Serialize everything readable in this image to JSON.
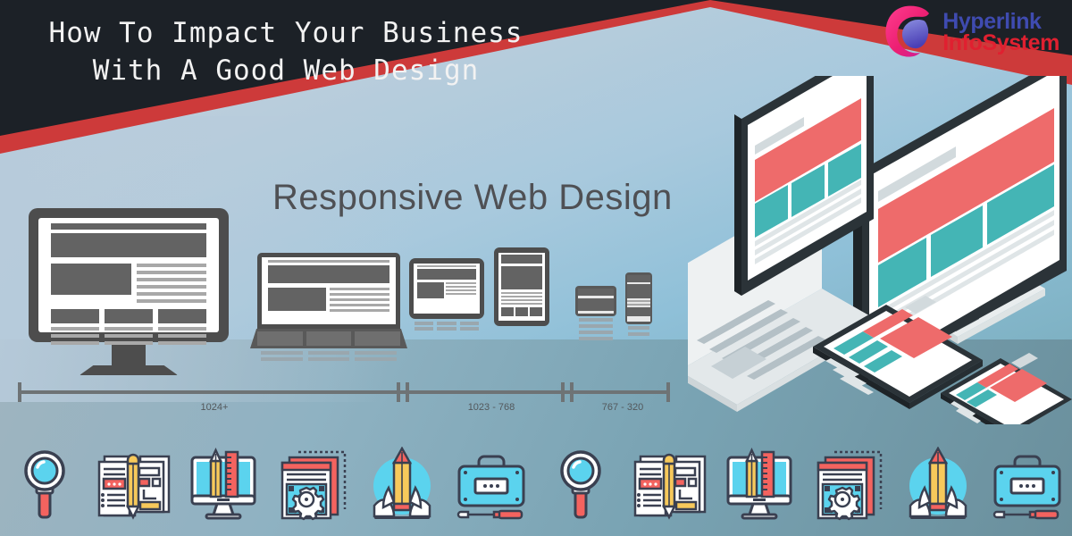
{
  "header": {
    "title": "How To Impact Your Business\nWith A Good Web Design",
    "title_line1": "How To Impact Your Business",
    "title_line2": "With A Good Web Design",
    "dark_color": "#1c2127",
    "accent_red": "#cd3a3a"
  },
  "logo": {
    "line1": "Hyperlink",
    "line2": "InfoSystem",
    "line1_color": "#3f4bb0",
    "line2_color": "#e02030",
    "mark_name": "hyperlink-swirl-logo",
    "mark_colors": [
      "#ff2d78",
      "#d6227a",
      "#5b5fc7",
      "#7a7fd8"
    ]
  },
  "diagram": {
    "heading": "Responsive Web Design",
    "heading_color": "#4f5054",
    "devices": [
      {
        "name": "desktop-monitor",
        "label": "Desktop"
      },
      {
        "name": "laptop",
        "label": "Laptop"
      },
      {
        "name": "tablet-landscape",
        "label": "Tablet landscape"
      },
      {
        "name": "tablet-portrait",
        "label": "Tablet portrait"
      },
      {
        "name": "phone-landscape",
        "label": "Phone landscape"
      },
      {
        "name": "phone-portrait",
        "label": "Phone portrait"
      }
    ],
    "ruler": {
      "segments": [
        {
          "label": "1024+",
          "center_pct": 30
        },
        {
          "label": "1023 - 768",
          "center_pct": 73
        },
        {
          "label": "767 - 320",
          "center_pct": 94
        }
      ],
      "labels": [
        "1024+",
        "1023 - 768",
        "767 - 320"
      ],
      "color": "#6e7375"
    }
  },
  "illustration": {
    "name": "isometric-devices",
    "items": [
      "laptop",
      "desktop-monitor",
      "tablet",
      "smartphone"
    ],
    "screen_colors": {
      "red": "#ee6b6b",
      "teal": "#44b5b5",
      "frame": "#2b3338",
      "body": "#eef1f2"
    }
  },
  "icons": {
    "colors": {
      "outline": "#3a4051",
      "cyan": "#5bd3ee",
      "red": "#f4635f",
      "yellow": "#f7c95b",
      "white": "#ffffff"
    },
    "items": [
      {
        "name": "magnifier-icon",
        "label": "Research"
      },
      {
        "name": "document-pencil-icon",
        "label": "Wireframe"
      },
      {
        "name": "monitor-design-tools-icon",
        "label": "Design"
      },
      {
        "name": "gear-layers-icon",
        "label": "Development"
      },
      {
        "name": "rocket-pencil-icon",
        "label": "Launch"
      },
      {
        "name": "toolbox-screwdriver-icon",
        "label": "Support"
      },
      {
        "name": "magnifier-icon",
        "label": "Research"
      },
      {
        "name": "document-pencil-icon",
        "label": "Wireframe"
      },
      {
        "name": "monitor-design-tools-icon",
        "label": "Design"
      },
      {
        "name": "gear-layers-icon",
        "label": "Development"
      },
      {
        "name": "rocket-pencil-icon",
        "label": "Launch"
      },
      {
        "name": "toolbox-screwdriver-icon",
        "label": "Support"
      }
    ]
  },
  "background": {
    "top_color": "#c2d3e2",
    "bottom_color": "#6a8f9c"
  }
}
